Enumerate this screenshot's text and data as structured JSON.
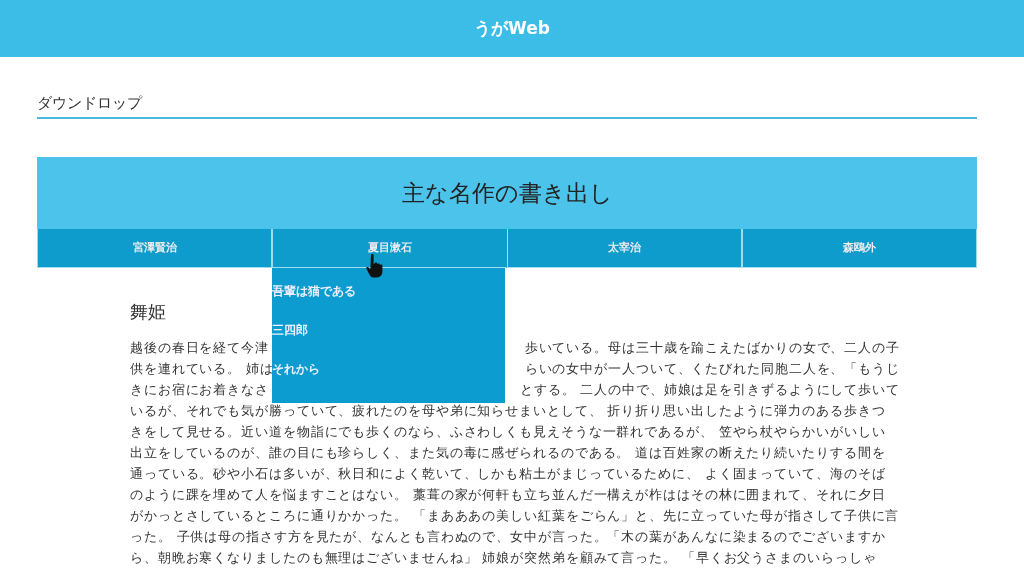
{
  "header": {
    "title": "うがWeb"
  },
  "section_title": "ダウンドロップ",
  "banner": {
    "title": "主な名作の書き出し"
  },
  "tabs": [
    {
      "label": "宮澤賢治",
      "open": false
    },
    {
      "label": "夏目漱石",
      "open": true,
      "menu": [
        "吾輩は猫である",
        "三四郎",
        "それから"
      ]
    },
    {
      "label": "太宰治",
      "open": false
    },
    {
      "label": "森鴎外",
      "open": false
    }
  ],
  "article": {
    "title": "舞姫",
    "lines": [
      {
        "left": "越後の春日を経て今津",
        "right": "歩いている。母は三十歳を踰こえたばかりの女で、二人の子"
      },
      {
        "left": "供を連れている。 姉は",
        "right": "らいの女中が一人ついて、くたびれた同胞二人を、「もうじ"
      },
      {
        "left": "きにお宿にお着きなさ",
        "right": "とする。 二人の中で、姉娘は足を引きずるようにして歩いて"
      },
      {
        "left": "いるが、それでも気が勝っていて、疲れたのを母や弟に知らせまいとして、 折り折り思い出したように弾力のある歩きつ"
      },
      {
        "left": "きをして見せる。近い道を物詣にでも歩くのなら、ふさわしくも見えそうな一群れであるが、 笠やら杖やらかいがいしい"
      },
      {
        "left": "出立をしているのが、誰の目にも珍らしく、また気の毒に感ぜられるのである。 道は百姓家の断えたり続いたりする間を"
      },
      {
        "left": "通っている。砂や小石は多いが、秋日和によく乾いて、しかも粘土がまじっているために、 よく固まっていて、海のそば"
      },
      {
        "left": "のように踝を埋めて人を悩ますことはない。 藁葺の家が何軒も立ち並んだ一構えが柞ははその林に囲まれて、それに夕日"
      },
      {
        "left": "がかっとさしているところに通りかかった。 「まあああの美しい紅葉をごらん」と、先に立っていた母が指さして子供に言"
      },
      {
        "left": "った。 子供は母の指さす方を見たが、なんとも言わぬので、女中が言った。「木の葉があんなに染まるのでございますか"
      },
      {
        "left": "ら、朝晩お寒くなりましたのも無理はございませんね」 姉娘が突然弟を顧みて言った。 「早くお父うさまのいらっしゃ"
      }
    ]
  }
}
